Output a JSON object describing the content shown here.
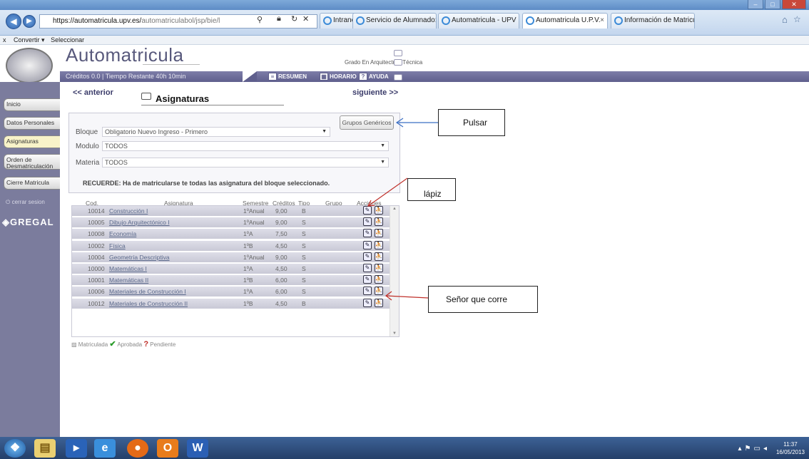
{
  "browser": {
    "url_host": "https://automatricula.upv.es/",
    "url_path": "automatriculabol/jsp/bie/l",
    "tabs": [
      {
        "label": "Intranet UPV"
      },
      {
        "label": "Servicio de Alumnado: ..."
      },
      {
        "label": "Automatricula - UPV"
      },
      {
        "label": "Automatricula U.P.V."
      },
      {
        "label": "Información de Matricu..."
      }
    ],
    "cmd_convert": "Convertir",
    "cmd_select": "Seleccionar",
    "close_x": "x"
  },
  "header": {
    "title": "Automatricula",
    "credits": "Créditos 0.0 | Tiempo Restante 40h 10min",
    "degree": "Grado En Arquitectura Técnica",
    "btn_resumen": "RESUMEN",
    "btn_horario": "HORARIO",
    "btn_ayuda": "AYUDA"
  },
  "sidebar": {
    "items": [
      {
        "label": "Inicio"
      },
      {
        "label": "Datos Personales"
      },
      {
        "label": "Asignaturas"
      },
      {
        "label": "Orden de Desmatriculación"
      },
      {
        "label": "Cierre Matricula"
      }
    ],
    "logout": "cerrar sesion",
    "brand": "GREGAL"
  },
  "main": {
    "prev": "<< anterior",
    "next": "siguiente >>",
    "section_title": "Asignaturas",
    "grupos_button": "Grupos Genéricos",
    "filters": {
      "bloque_label": "Bloque",
      "bloque_value": "Obligatorio Nuevo Ingreso - Primero",
      "modulo_label": "Modulo",
      "modulo_value": "TODOS",
      "materia_label": "Materia",
      "materia_value": "TODOS"
    },
    "reminder": "RECUERDE: Ha de matricularse te todas las asignatura del bloque seleccionado.",
    "columns": {
      "cod": "Cod.",
      "asignatura": "Asignatura",
      "semestre": "Semestre",
      "creditos": "Créditos",
      "tipo": "Tipo",
      "grupo": "Grupo",
      "acciones": "Acciones"
    },
    "rows": [
      {
        "cod": "10014",
        "asignatura": "Construcción I",
        "semestre": "1ºAnual",
        "creditos": "9,00",
        "tipo": "B"
      },
      {
        "cod": "10005",
        "asignatura": "Dibujo Arquitectónico I",
        "semestre": "1ºAnual",
        "creditos": "9,00",
        "tipo": "S"
      },
      {
        "cod": "10008",
        "asignatura": "Economía",
        "semestre": "1ºA",
        "creditos": "7,50",
        "tipo": "S"
      },
      {
        "cod": "10002",
        "asignatura": "Física",
        "semestre": "1ºB",
        "creditos": "4,50",
        "tipo": "S"
      },
      {
        "cod": "10004",
        "asignatura": "Geometría Descriptiva",
        "semestre": "1ºAnual",
        "creditos": "9,00",
        "tipo": "S"
      },
      {
        "cod": "10000",
        "asignatura": "Matemáticas I",
        "semestre": "1ºA",
        "creditos": "4,50",
        "tipo": "S"
      },
      {
        "cod": "10001",
        "asignatura": "Matemáticas II",
        "semestre": "1ºB",
        "creditos": "6,00",
        "tipo": "S"
      },
      {
        "cod": "10006",
        "asignatura": "Materiales de Construcción I",
        "semestre": "1ºA",
        "creditos": "6,00",
        "tipo": "S"
      },
      {
        "cod": "10012",
        "asignatura": "Materiales de Construcción II",
        "semestre": "1ºB",
        "creditos": "4,50",
        "tipo": "B"
      }
    ],
    "legend": {
      "matriculada": "Matriculada",
      "aprobada": "Aprobada",
      "pendiente": "Pendiente"
    }
  },
  "annotations": {
    "pulsar": "Pulsar",
    "lapiz": "lápiz",
    "senor": "Señor que corre"
  },
  "taskbar": {
    "time": "11:37",
    "date": "16/05/2013"
  },
  "colors": {
    "accent": "#5f5f8d",
    "arrow_blue": "#3b6fc4",
    "arrow_red": "#c0302a"
  }
}
